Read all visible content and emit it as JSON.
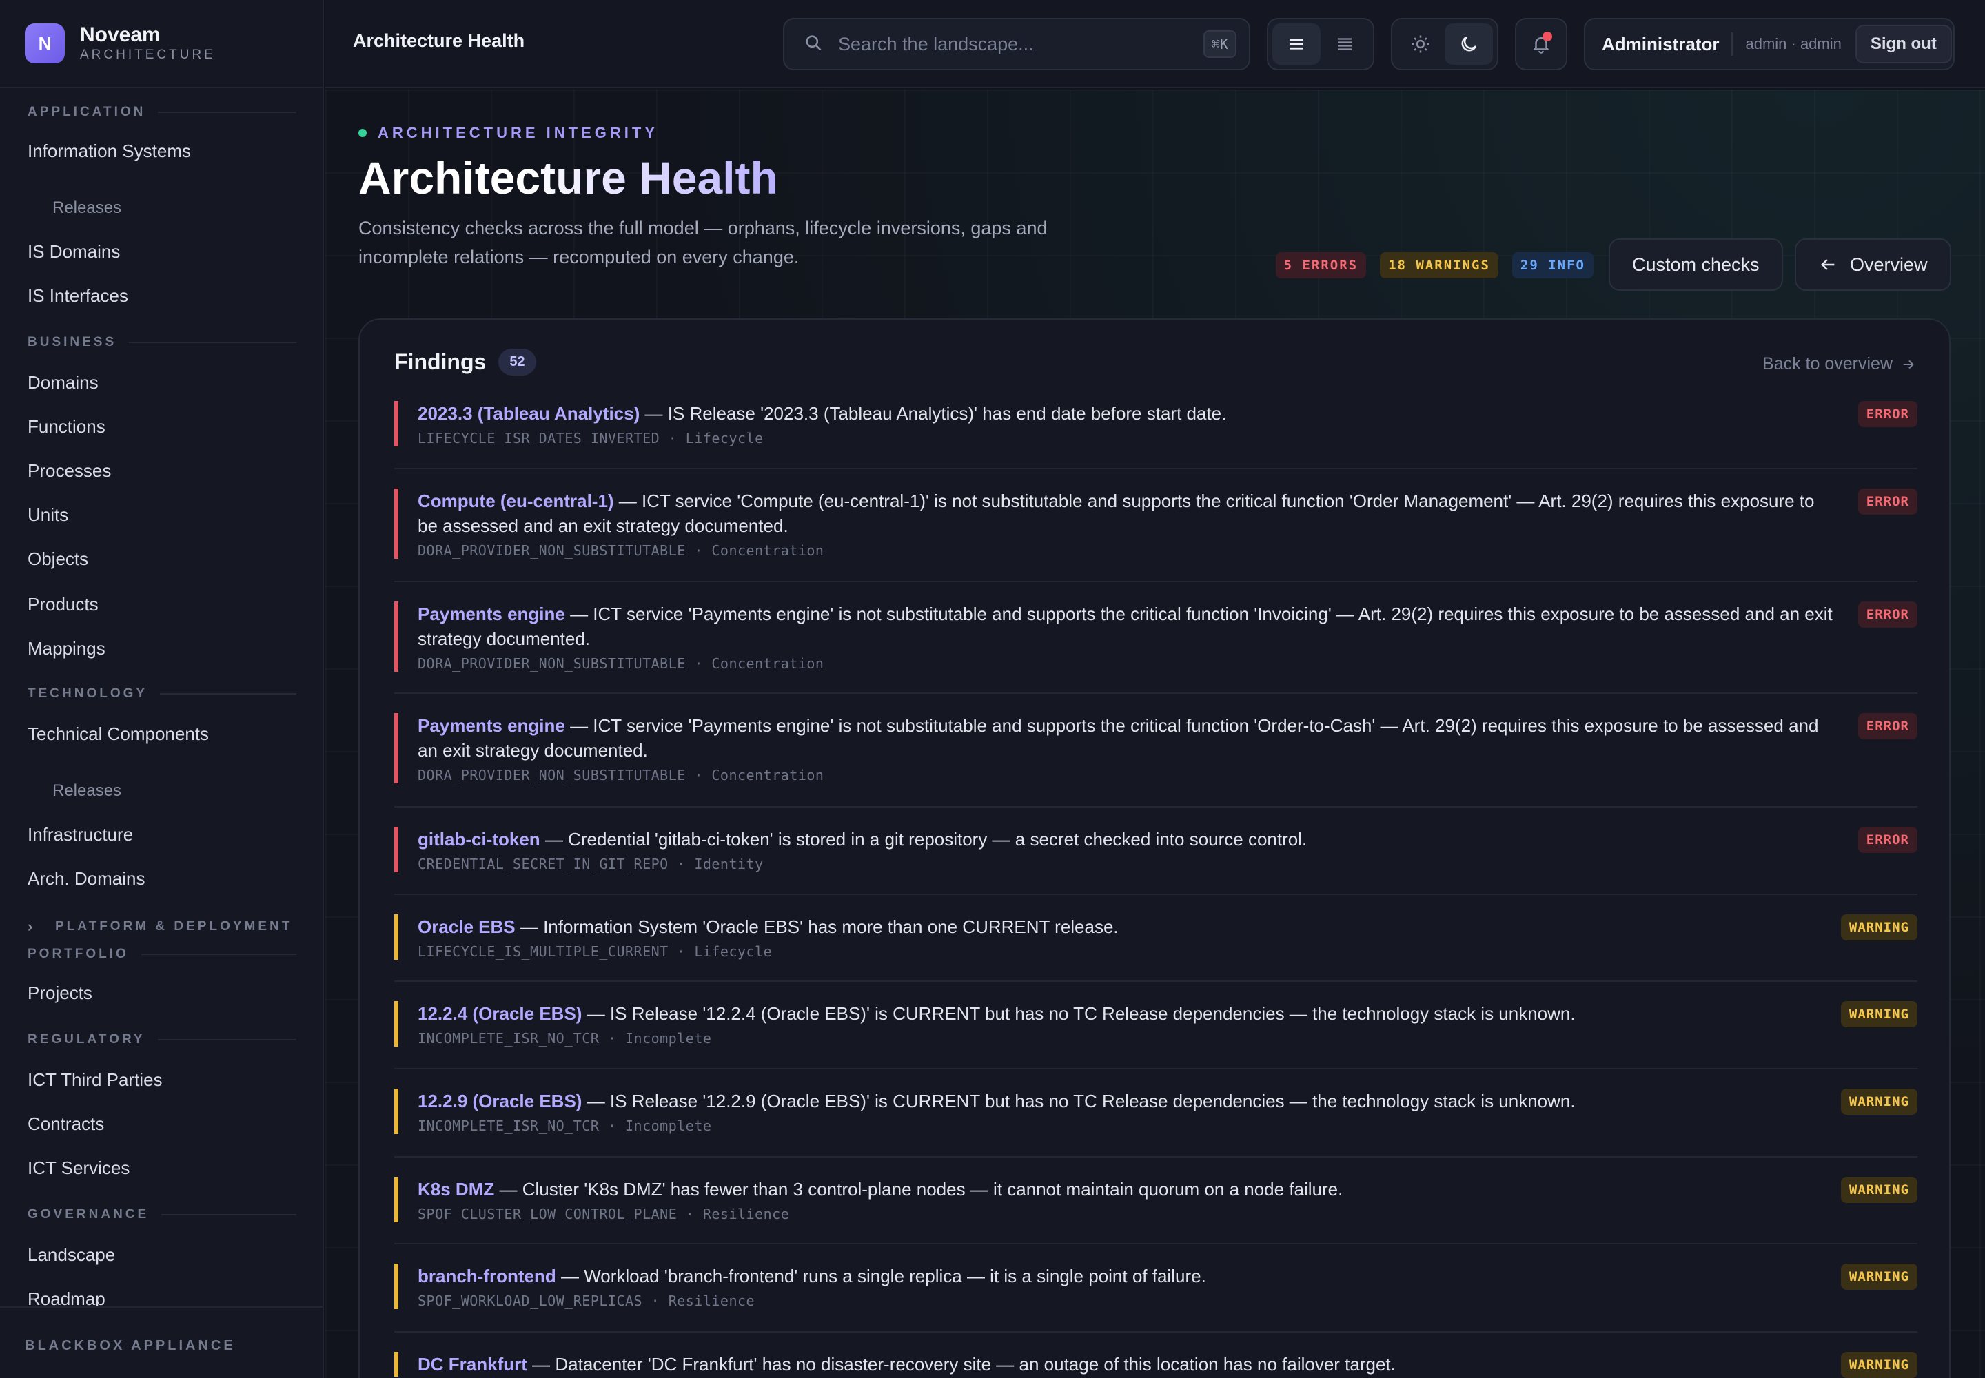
{
  "brand": {
    "name": "Noveam",
    "subtitle": "ARCHITECTURE",
    "logo_letter": "N"
  },
  "sidebar": {
    "sections": [
      {
        "label": "APPLICATION"
      },
      {
        "label": "BUSINESS"
      },
      {
        "label": "TECHNOLOGY"
      },
      {
        "label": "PORTFOLIO"
      },
      {
        "label": "REGULATORY"
      },
      {
        "label": "GOVERNANCE"
      }
    ],
    "items": [
      "Information Systems",
      "Releases",
      "IS Domains",
      "IS Interfaces",
      "Domains",
      "Functions",
      "Processes",
      "Units",
      "Objects",
      "Products",
      "Mappings",
      "Technical Components",
      "Releases",
      "Infrastructure",
      "Arch. Domains",
      "Projects",
      "ICT Third Parties",
      "Contracts",
      "ICT Services",
      "Landscape",
      "Roadmap"
    ],
    "collapsed_group": "PLATFORM & DEPLOYMENT",
    "footer": "BLACKBOX APPLIANCE"
  },
  "topbar": {
    "title": "Architecture Health",
    "search_placeholder": "Search the landscape...",
    "search_shortcut": "⌘K",
    "user_name": "Administrator",
    "user_login": "admin · admin",
    "signout_label": "Sign out"
  },
  "header": {
    "eyebrow": "ARCHITECTURE INTEGRITY",
    "title": "Architecture Health",
    "description": "Consistency checks across the full model — orphans, lifecycle inversions, gaps and incomplete relations — recomputed on every change.",
    "errors": "5 ERRORS",
    "warnings": "18 WARNINGS",
    "info": "29 INFO",
    "custom_checks_label": "Custom checks",
    "overview_label": "Overview"
  },
  "findings": {
    "title": "Findings",
    "count": "52",
    "back_label": "Back to overview",
    "items": [
      {
        "name": "2023.3 (Tableau Analytics)",
        "text": " — IS Release '2023.3 (Tableau Analytics)' has end date before start date.",
        "code": "LIFECYCLE_ISR_DATES_INVERTED · Lifecycle",
        "severity": "ERROR"
      },
      {
        "name": "Compute (eu-central-1)",
        "text": " — ICT service 'Compute (eu-central-1)' is not substitutable and supports the critical function 'Order Management' — Art. 29(2) requires this exposure to be assessed and an exit strategy documented.",
        "code": "DORA_PROVIDER_NON_SUBSTITUTABLE · Concentration",
        "severity": "ERROR"
      },
      {
        "name": "Payments engine",
        "text": " — ICT service 'Payments engine' is not substitutable and supports the critical function 'Invoicing' — Art. 29(2) requires this exposure to be assessed and an exit strategy documented.",
        "code": "DORA_PROVIDER_NON_SUBSTITUTABLE · Concentration",
        "severity": "ERROR"
      },
      {
        "name": "Payments engine",
        "text": " — ICT service 'Payments engine' is not substitutable and supports the critical function 'Order-to-Cash' — Art. 29(2) requires this exposure to be assessed and an exit strategy documented.",
        "code": "DORA_PROVIDER_NON_SUBSTITUTABLE · Concentration",
        "severity": "ERROR"
      },
      {
        "name": "gitlab-ci-token",
        "text": " — Credential 'gitlab-ci-token' is stored in a git repository — a secret checked into source control.",
        "code": "CREDENTIAL_SECRET_IN_GIT_REPO · Identity",
        "severity": "ERROR"
      },
      {
        "name": "Oracle EBS",
        "text": " — Information System 'Oracle EBS' has more than one CURRENT release.",
        "code": "LIFECYCLE_IS_MULTIPLE_CURRENT · Lifecycle",
        "severity": "WARNING"
      },
      {
        "name": "12.2.4 (Oracle EBS)",
        "text": " — IS Release '12.2.4 (Oracle EBS)' is CURRENT but has no TC Release dependencies — the technology stack is unknown.",
        "code": "INCOMPLETE_ISR_NO_TCR · Incomplete",
        "severity": "WARNING"
      },
      {
        "name": "12.2.9 (Oracle EBS)",
        "text": " — IS Release '12.2.9 (Oracle EBS)' is CURRENT but has no TC Release dependencies — the technology stack is unknown.",
        "code": "INCOMPLETE_ISR_NO_TCR · Incomplete",
        "severity": "WARNING"
      },
      {
        "name": "K8s DMZ",
        "text": " — Cluster 'K8s DMZ' has fewer than 3 control-plane nodes — it cannot maintain quorum on a node failure.",
        "code": "SPOF_CLUSTER_LOW_CONTROL_PLANE · Resilience",
        "severity": "WARNING"
      },
      {
        "name": "branch-frontend",
        "text": " — Workload 'branch-frontend' runs a single replica — it is a single point of failure.",
        "code": "SPOF_WORKLOAD_LOW_REPLICAS · Resilience",
        "severity": "WARNING"
      },
      {
        "name": "DC Frankfurt",
        "text": " — Datacenter 'DC Frankfurt' has no disaster-recovery site — an outage of this location has no failover target.",
        "code": "",
        "severity": "WARNING"
      }
    ]
  }
}
